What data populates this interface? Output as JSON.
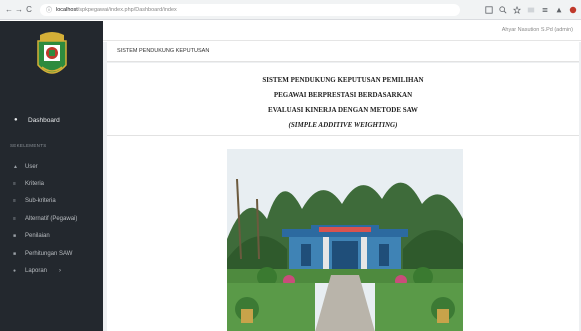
{
  "browser": {
    "url_host": "localhost",
    "url_path": "/spkpegawai/index.php/Dashboard/index",
    "back_icon": "←",
    "forward_icon": "→",
    "reload_icon": "C",
    "info_icon": "ⓘ"
  },
  "sidebar": {
    "active_item": "Dashboard",
    "section_label": "SEKELEMENTS",
    "items": [
      {
        "label": "User",
        "icon": "user-icon"
      },
      {
        "label": "Kriteria",
        "icon": "list-icon"
      },
      {
        "label": "Sub-kriteria",
        "icon": "list-icon"
      },
      {
        "label": "Alternatif (Pegawai)",
        "icon": "list-icon"
      },
      {
        "label": "Penilaian",
        "icon": "table-icon"
      },
      {
        "label": "Perhitungan SAW",
        "icon": "table-icon"
      },
      {
        "label": "Laporan",
        "icon": "file-icon",
        "chevron": "›"
      }
    ]
  },
  "topbar": {
    "user": "Ahyar Nasution S.Pd (admin)"
  },
  "main": {
    "panel_title": "SISTEM PENDUKUNG KEPUTUSAN",
    "title_lines": [
      "SISTEM PENDUKUNG KEPUTUSAN PEMILIHAN",
      "PEGAWAI  BERPRESTASI BERDASARKAN",
      "EVALUASI KINERJA  DENGAN METODE SAW",
      "(SIMPLE ADDITIVE WEIGHTING)"
    ]
  },
  "colors": {
    "sidebar_bg": "#23282e",
    "content_bg": "#eef0f2"
  }
}
